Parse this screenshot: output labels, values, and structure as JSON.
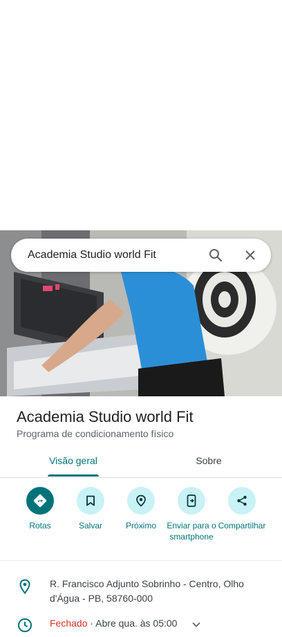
{
  "search": {
    "query": "Academia Studio world Fit"
  },
  "place": {
    "title": "Academia Studio world Fit",
    "category": "Programa de condicionamento físico"
  },
  "tabs": [
    {
      "label": "Visão geral",
      "active": true
    },
    {
      "label": "Sobre",
      "active": false
    }
  ],
  "actions": [
    {
      "label": "Rotas",
      "icon": "directions-icon"
    },
    {
      "label": "Salvar",
      "icon": "bookmark-icon"
    },
    {
      "label": "Próximo",
      "icon": "nearby-icon"
    },
    {
      "label": "Enviar para o smartphone",
      "icon": "send-to-phone-icon"
    },
    {
      "label": "Compartilhar",
      "icon": "share-icon"
    }
  ],
  "info": {
    "address": "R. Francisco Adjunto Sobrinho - Centro, Olho d'Água - PB, 58760-000",
    "hours_status": "Fechado",
    "hours_detail": " · Abre qua. às 05:00"
  },
  "colors": {
    "accent": "#00737a",
    "accent_light": "#c8f2f5",
    "closed": "#d93025"
  }
}
